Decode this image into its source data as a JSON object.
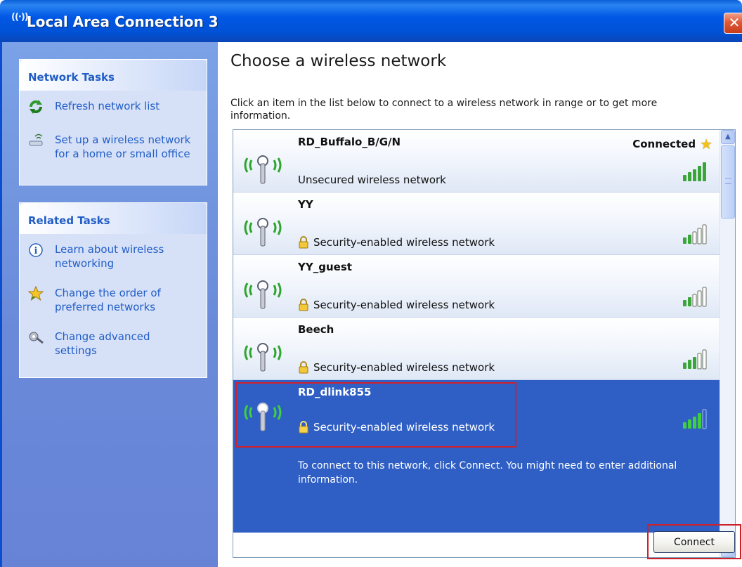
{
  "window": {
    "title": "Local Area Connection 3",
    "title_icon": "((·))",
    "close_glyph": "✕"
  },
  "left_pane": {
    "network_tasks": {
      "header": "Network Tasks",
      "items": [
        {
          "label": "Refresh network list",
          "icon": "refresh-icon"
        },
        {
          "label": "Set up a wireless network for a home or small office",
          "icon": "wireless-setup-icon"
        }
      ]
    },
    "related_tasks": {
      "header": "Related Tasks",
      "items": [
        {
          "label": "Learn about wireless networking",
          "icon": "info-icon"
        },
        {
          "label": "Change the order of preferred networks",
          "icon": "star-icon"
        },
        {
          "label": "Change advanced settings",
          "icon": "settings-icon"
        }
      ]
    }
  },
  "main": {
    "heading": "Choose a wireless network",
    "instructions": "Click an item in the list below to connect to a wireless network in range or to get more information.",
    "networks": [
      {
        "name": "RD_Buffalo_B/G/N",
        "description": "Unsecured wireless network",
        "status": "Connected",
        "secured": false,
        "signal_bars": 5
      },
      {
        "name": "YY",
        "description": "Security-enabled wireless network",
        "status": "",
        "secured": true,
        "signal_bars": 2
      },
      {
        "name": "YY_guest",
        "description": "Security-enabled wireless network",
        "status": "",
        "secured": true,
        "signal_bars": 2
      },
      {
        "name": "Beech",
        "description": "Security-enabled wireless network",
        "status": "",
        "secured": true,
        "signal_bars": 3
      },
      {
        "name": "RD_dlink855",
        "description": "Security-enabled wireless network",
        "status": "",
        "secured": true,
        "signal_bars": 4,
        "selected": true,
        "info": "To connect to this network, click Connect. You might need to enter additional information."
      }
    ],
    "connect_label": "Connect"
  },
  "colors": {
    "titlebar": "#0058e6",
    "left_pane": "#7ba2e7",
    "selected_row": "#2f5fc4",
    "link_text": "#215dc6",
    "highlight": "#d0202a",
    "signal_on": "#3aa63a"
  }
}
